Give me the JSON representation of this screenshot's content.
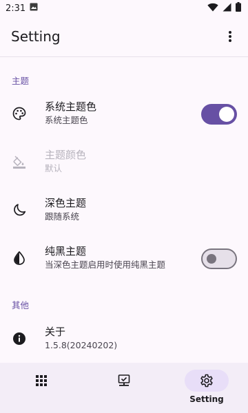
{
  "status_bar": {
    "time": "2:31"
  },
  "app_bar": {
    "title": "Setting"
  },
  "sections": {
    "theme": {
      "header": "主题"
    },
    "other": {
      "header": "其他"
    }
  },
  "rows": {
    "system_theme_color": {
      "title": "系统主题色",
      "subtitle": "系统主题色",
      "switch": "on"
    },
    "theme_color": {
      "title": "主题颜色",
      "subtitle": "默认",
      "disabled": true
    },
    "dark_theme": {
      "title": "深色主题",
      "subtitle": "跟随系统"
    },
    "pure_black": {
      "title": "纯黑主题",
      "subtitle": "当深色主题启用时使用纯黑主题",
      "switch": "off"
    },
    "about": {
      "title": "关于",
      "subtitle": "1.5.8(20240202)"
    }
  },
  "bottom_nav": {
    "items": [
      {
        "icon": "grid-icon",
        "label": ""
      },
      {
        "icon": "computer-check-icon",
        "label": ""
      },
      {
        "icon": "gear-icon",
        "label": "Setting",
        "active": true
      }
    ]
  },
  "colors": {
    "accent": "#6750a4",
    "nav_bg": "#f3edf7",
    "pill": "#e8def8"
  }
}
